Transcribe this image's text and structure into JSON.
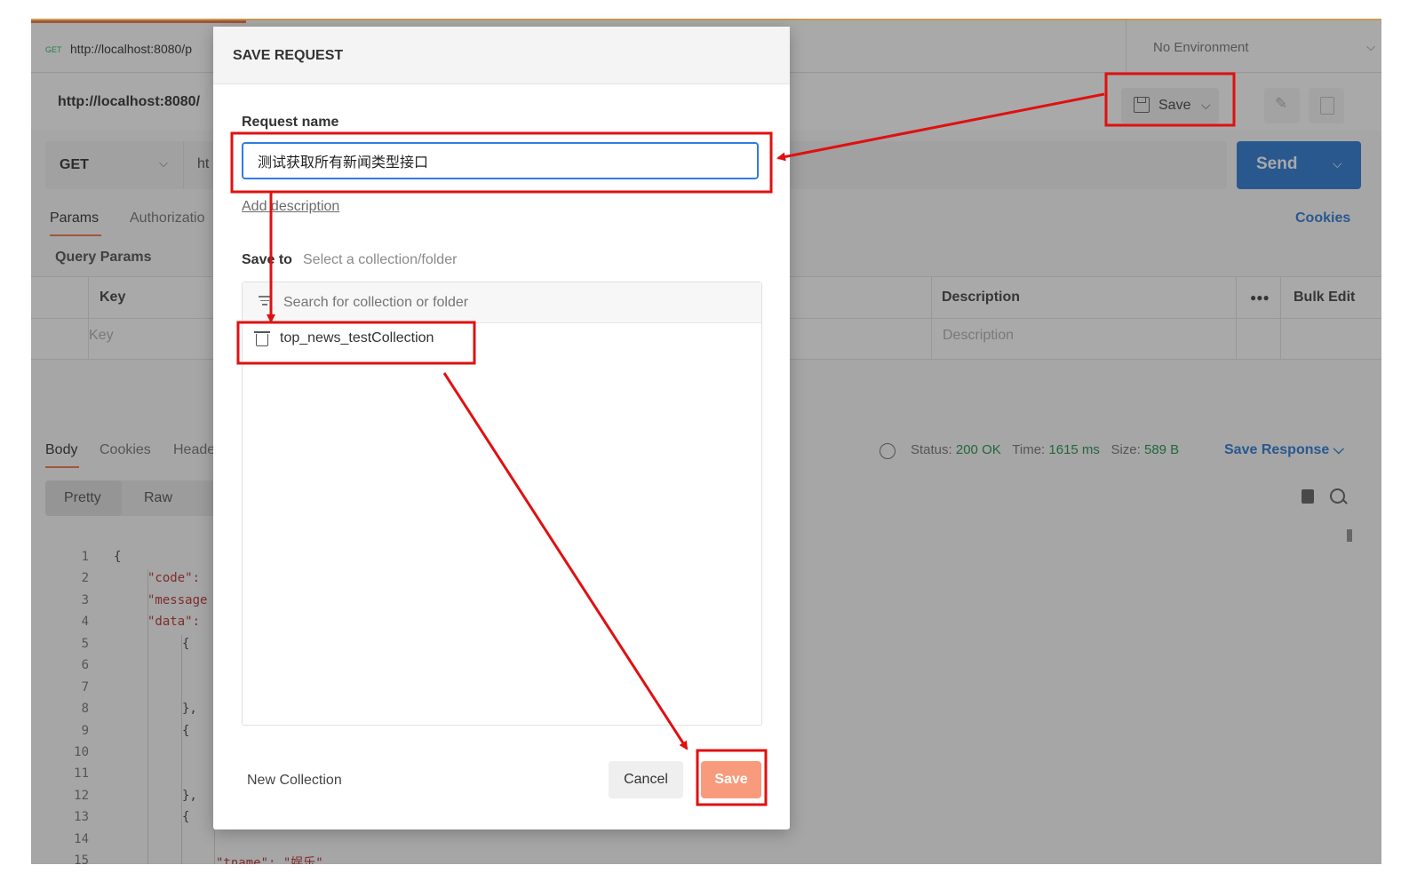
{
  "tab": {
    "method": "GET",
    "url": "http://localhost:8080/p"
  },
  "environment": {
    "label": "No Environment"
  },
  "request": {
    "title": "http://localhost:8080/",
    "method": "GET",
    "url_fragment": "ht"
  },
  "toolbar": {
    "save_label": "Save"
  },
  "send": {
    "label": "Send"
  },
  "request_tabs": [
    "Params",
    "Authorizatio"
  ],
  "cookies_label": "Cookies",
  "query_params": {
    "label": "Query Params",
    "headers": [
      "Key",
      "Description",
      "Bulk Edit"
    ],
    "placeholders": [
      "Key",
      "Description"
    ]
  },
  "response": {
    "tabs": [
      "Body",
      "Cookies",
      "Heade"
    ],
    "status_label": "Status:",
    "status_value": "200 OK",
    "time_label": "Time:",
    "time_value": "1615 ms",
    "size_label": "Size:",
    "size_value": "589 B",
    "save_response": "Save Response",
    "format_tabs": [
      "Pretty",
      "Raw"
    ]
  },
  "code_lines": [
    {
      "n": "1",
      "text": "{"
    },
    {
      "n": "2",
      "text": "\"code\":"
    },
    {
      "n": "3",
      "text": "\"message"
    },
    {
      "n": "4",
      "text": "\"data\":"
    },
    {
      "n": "5",
      "text": "{"
    },
    {
      "n": "6",
      "text": ""
    },
    {
      "n": "7",
      "text": ""
    },
    {
      "n": "8",
      "text": "},"
    },
    {
      "n": "9",
      "text": "{"
    },
    {
      "n": "10",
      "text": ""
    },
    {
      "n": "11",
      "text": ""
    },
    {
      "n": "12",
      "text": "},"
    },
    {
      "n": "13",
      "text": "{"
    },
    {
      "n": "14",
      "text": ""
    },
    {
      "n": "15",
      "text": "\"tname\": \"娱乐\""
    }
  ],
  "modal": {
    "title": "SAVE REQUEST",
    "request_name_label": "Request name",
    "request_name_value": "测试获取所有新闻类型接口",
    "add_description": "Add description",
    "save_to_label": "Save to",
    "save_to_value": "Select a collection/folder",
    "search_placeholder": "Search for collection or folder",
    "collections": [
      "top_news_testCollection"
    ],
    "new_collection": "New Collection",
    "cancel_label": "Cancel",
    "save_label": "Save"
  },
  "annotation_color": "#e01010",
  "icons": [
    "save-icon",
    "pencil-icon",
    "document-icon",
    "globe-icon",
    "copy-icon",
    "search-icon",
    "filter-icon",
    "collection-icon",
    "chevron-down-icon"
  ]
}
